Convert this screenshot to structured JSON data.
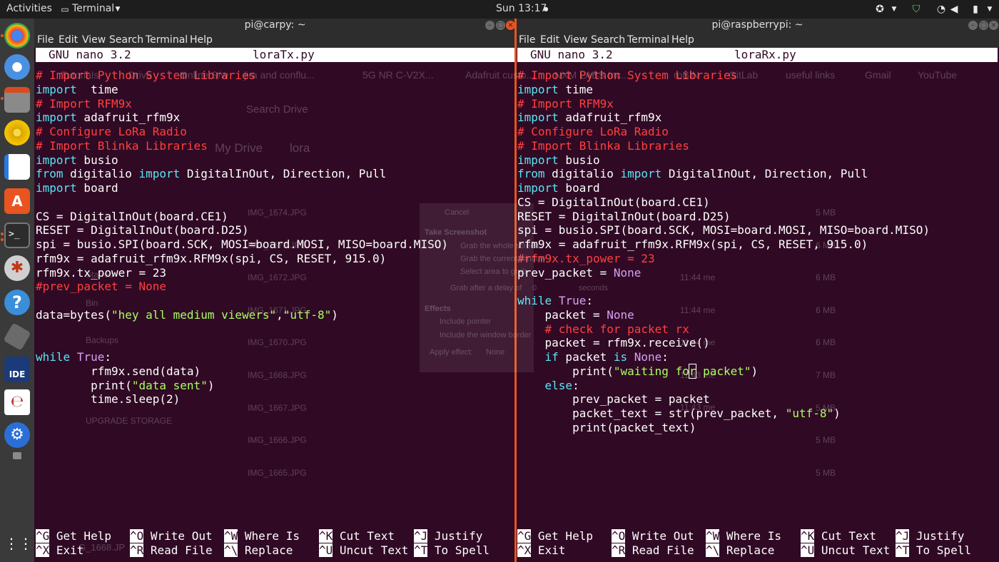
{
  "topbar": {
    "activities": "Activities",
    "app_menu": "Terminal",
    "clock": "Sun 13:17"
  },
  "dock": {
    "items": [
      "chrome-icon",
      "chromium-icon",
      "files-icon",
      "rhythmbox-icon",
      "writer-icon",
      "software-icon",
      "terminal-icon",
      "settings-icon",
      "help-icon",
      "disk-icon",
      "arduino-ide-icon",
      "scanner-icon",
      "circuit-icon",
      "trash-icon"
    ],
    "ide_label": "IDE"
  },
  "left_window": {
    "title": "pi@carpy: ~",
    "menu": [
      "File",
      "Edit",
      "View",
      "Search",
      "Terminal",
      "Help"
    ],
    "nano_version": "GNU nano 3.2",
    "filename": "loraTx.py",
    "shortcuts_row1": [
      [
        "^G",
        "Get Help"
      ],
      [
        "^O",
        "Write Out"
      ],
      [
        "^W",
        "Where Is"
      ],
      [
        "^K",
        "Cut Text"
      ],
      [
        "^J",
        "Justify"
      ]
    ],
    "shortcuts_row2": [
      [
        "^X",
        "Exit"
      ],
      [
        "^R",
        "Read File"
      ],
      [
        "^\\",
        "Replace"
      ],
      [
        "^U",
        "Uncut Text"
      ],
      [
        "^T",
        "To Spell"
      ]
    ]
  },
  "right_window": {
    "title": "pi@raspberrypi: ~",
    "menu": [
      "File",
      "Edit",
      "View",
      "Search",
      "Terminal",
      "Help"
    ],
    "nano_version": "GNU nano 3.2",
    "filename": "loraRx.py",
    "shortcuts_row1": [
      [
        "^G",
        "Get Help"
      ],
      [
        "^O",
        "Write Out"
      ],
      [
        "^W",
        "Where Is"
      ],
      [
        "^K",
        "Cut Text"
      ],
      [
        "^J",
        "Justify"
      ]
    ],
    "shortcuts_row2": [
      [
        "^X",
        "Exit"
      ],
      [
        "^R",
        "Read File"
      ],
      [
        "^\\",
        "Replace"
      ],
      [
        "^U",
        "Uncut Text"
      ],
      [
        "^T",
        "To Spell"
      ]
    ]
  },
  "left_code": [
    [
      [
        "cm",
        "# Import Python System Libraries"
      ]
    ],
    [
      [
        "kw",
        "import"
      ],
      [
        "",
        "  time"
      ]
    ],
    [
      [
        "cm",
        "# Import RFM9x"
      ]
    ],
    [
      [
        "kw",
        "import"
      ],
      [
        "",
        " adafruit_rfm9x"
      ]
    ],
    [
      [
        "cm",
        "# Configure LoRa Radio"
      ]
    ],
    [
      [
        "cm",
        "# Import Blinka Libraries"
      ]
    ],
    [
      [
        "kw",
        "import"
      ],
      [
        "",
        " busio"
      ]
    ],
    [
      [
        "kw",
        "from"
      ],
      [
        "",
        " digitalio "
      ],
      [
        "kw",
        "import"
      ],
      [
        "",
        " DigitalInOut, Direction, Pull"
      ]
    ],
    [
      [
        "kw",
        "import"
      ],
      [
        "",
        " board"
      ]
    ],
    [],
    [
      [
        "",
        "CS = DigitalInOut(board.CE1)"
      ]
    ],
    [
      [
        "",
        "RESET = DigitalInOut(board.D25)"
      ]
    ],
    [
      [
        "",
        "spi = busio.SPI(board.SCK, MOSI=board.MOSI, MISO=board.MISO)"
      ]
    ],
    [
      [
        "",
        "rfm9x = adafruit_rfm9x.RFM9x(spi, CS, RESET, 915.0)"
      ]
    ],
    [
      [
        "",
        "rfm9x.tx_power = 23"
      ]
    ],
    [
      [
        "cm",
        "#prev_packet = None"
      ]
    ],
    [],
    [
      [
        "",
        "data=bytes("
      ],
      [
        "st",
        "\"hey all medium viewers\""
      ],
      [
        "",
        ","
      ],
      [
        "st",
        "\"utf-8\""
      ],
      [
        "",
        ")"
      ]
    ],
    [],
    [],
    [
      [
        "kw",
        "while"
      ],
      [
        "",
        " "
      ],
      [
        "bi",
        "True"
      ],
      [
        "",
        ":"
      ]
    ],
    [
      [
        "",
        "        rfm9x.send(data)"
      ]
    ],
    [
      [
        "",
        "        print("
      ],
      [
        "st",
        "\"data sent\""
      ],
      [
        "",
        ")"
      ]
    ],
    [
      [
        "",
        "        time.sleep(2)"
      ]
    ]
  ],
  "right_code": [
    [
      [
        "cm",
        "# Import Python System Libraries"
      ]
    ],
    [
      [
        "kw",
        "import"
      ],
      [
        "",
        " time"
      ]
    ],
    [
      [
        "cm",
        "# Import RFM9x"
      ]
    ],
    [
      [
        "kw",
        "import"
      ],
      [
        "",
        " adafruit_rfm9x"
      ]
    ],
    [
      [
        "cm",
        "# Configure LoRa Radio"
      ]
    ],
    [
      [
        "cm",
        "# Import Blinka Libraries"
      ]
    ],
    [
      [
        "kw",
        "import"
      ],
      [
        "",
        " busio"
      ]
    ],
    [
      [
        "kw",
        "from"
      ],
      [
        "",
        " digitalio "
      ],
      [
        "kw",
        "import"
      ],
      [
        "",
        " DigitalInOut, Direction, Pull"
      ]
    ],
    [
      [
        "kw",
        "import"
      ],
      [
        "",
        " board"
      ]
    ],
    [
      [
        "",
        "CS = DigitalInOut(board.CE1)"
      ]
    ],
    [
      [
        "",
        "RESET = DigitalInOut(board.D25)"
      ]
    ],
    [
      [
        "",
        "spi = busio.SPI(board.SCK, MOSI=board.MOSI, MISO=board.MISO)"
      ]
    ],
    [
      [
        "",
        "rfm9x = adafruit_rfm9x.RFM9x(spi, CS, RESET, 915.0)"
      ]
    ],
    [
      [
        "cm",
        "#rfm9x.tx_power = 23"
      ]
    ],
    [
      [
        "",
        "prev_packet = "
      ],
      [
        "bi",
        "None"
      ]
    ],
    [],
    [
      [
        "kw",
        "while"
      ],
      [
        "",
        " "
      ],
      [
        "bi",
        "True"
      ],
      [
        "",
        ":"
      ]
    ],
    [
      [
        "",
        "    packet = "
      ],
      [
        "bi",
        "None"
      ]
    ],
    [
      [
        "",
        "    "
      ],
      [
        "cm",
        "# check for packet rx"
      ]
    ],
    [
      [
        "",
        "    packet = rfm9x.receive()"
      ]
    ],
    [
      [
        "",
        "    "
      ],
      [
        "kw",
        "if"
      ],
      [
        "",
        " packet "
      ],
      [
        "kw",
        "is"
      ],
      [
        "",
        " "
      ],
      [
        "bi",
        "None"
      ],
      [
        "",
        ":"
      ]
    ],
    [
      [
        "",
        "        print("
      ],
      [
        "st",
        "\"waiting fo"
      ],
      [
        "cur",
        "r"
      ],
      [
        "st",
        " packet\""
      ],
      [
        "",
        ")"
      ]
    ],
    [
      [
        "",
        "    "
      ],
      [
        "kw",
        "else"
      ],
      [
        "",
        ":"
      ]
    ],
    [
      [
        "",
        "        prev_packet = packet"
      ]
    ],
    [
      [
        "",
        "        packet_text = str(prev_packet, "
      ],
      [
        "st",
        "\"utf-8\""
      ],
      [
        "",
        ")"
      ]
    ],
    [
      [
        "",
        "        print(packet_text)"
      ]
    ]
  ],
  "ghost": {
    "bookmarks": [
      "Tutorials",
      "Drive",
      "Online S/w",
      "jira and conflu...",
      "5G NR C-V2X...",
      "Adafruit custo...",
      "NXM LABS Inc...",
      "roBIN",
      "GitLab",
      "useful links",
      "Gmail",
      "YouTube"
    ],
    "search_placeholder": "Search Drive",
    "breadcrumb_root": "My Drive",
    "breadcrumb_folder": "lora",
    "files": [
      "IMG_1674.JPG",
      "IMG_1673.JPG",
      "IMG_1672.JPG",
      "IMG_1671.JPG",
      "IMG_1670.JPG",
      "IMG_1668.JPG",
      "IMG_1667.JPG",
      "IMG_1666.JPG",
      "IMG_1665.JPG"
    ],
    "sidebar": [
      "Starred",
      "Bin",
      "Backups",
      "UPGRADE STORAGE"
    ],
    "sizes": [
      "5 MB",
      "6 MB",
      "6 MB",
      "6 MB",
      "6 MB",
      "7 MB",
      "5 MB",
      "5 MB",
      "5 MB"
    ],
    "times": [
      "11:44 me",
      "11:44 me",
      "11:44 me",
      "11:43 me",
      "11:43 me"
    ],
    "dialog": {
      "cancel": "Cancel",
      "take_screenshot": "Take Screenshot",
      "opt1": "Grab the whole screen",
      "opt2": "Grab the current window",
      "opt3": "Select area to grab",
      "delay": "Grab after a delay of",
      "delay_value": "0",
      "seconds": "seconds",
      "effects": "Effects",
      "pointer": "Include pointer",
      "border": "Include the window border",
      "apply": "Apply effect:",
      "apply_value": "None"
    },
    "bottom_file": "G_1668.JP"
  }
}
